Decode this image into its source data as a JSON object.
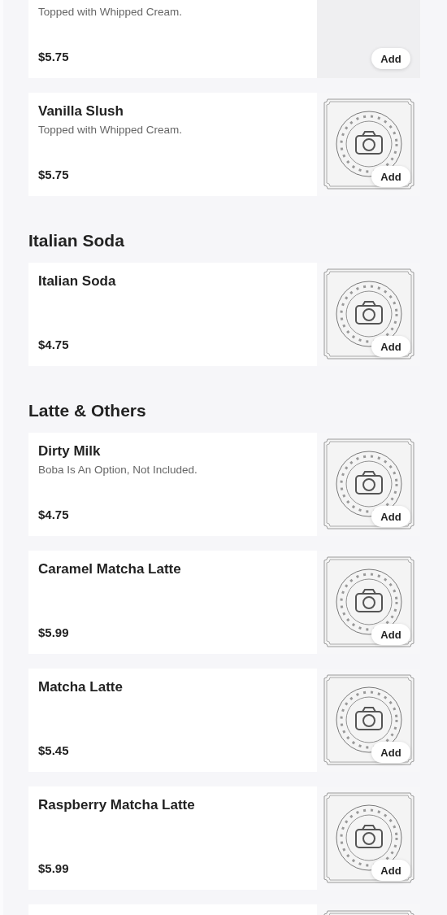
{
  "sections": [
    {
      "items": [
        {
          "description": "Topped with Whipped Cream.",
          "price": "$5.75",
          "kind": "empty",
          "add": "Add"
        },
        {
          "name": "Vanilla Slush",
          "description": "Topped with Whipped Cream.",
          "price": "$5.75",
          "kind": "picture",
          "add": "Add"
        }
      ]
    },
    {
      "heading": "Italian Soda",
      "items": [
        {
          "name": "Italian Soda",
          "price": "$4.75",
          "kind": "picture",
          "add": "Add"
        }
      ]
    },
    {
      "heading": "Latte & Others",
      "items": [
        {
          "name": "Dirty Milk",
          "description": "Boba Is An Option, Not Included.",
          "price": "$4.75",
          "kind": "picture",
          "add": "Add"
        },
        {
          "name": "Caramel Matcha Latte",
          "price": "$5.99",
          "kind": "picture",
          "add": "Add"
        },
        {
          "name": "Matcha Latte",
          "price": "$5.45",
          "kind": "picture",
          "add": "Add"
        },
        {
          "name": "Raspberry Matcha Latte",
          "price": "$5.99",
          "kind": "picture",
          "add": "Add"
        },
        {
          "kind": "picture"
        }
      ]
    }
  ]
}
